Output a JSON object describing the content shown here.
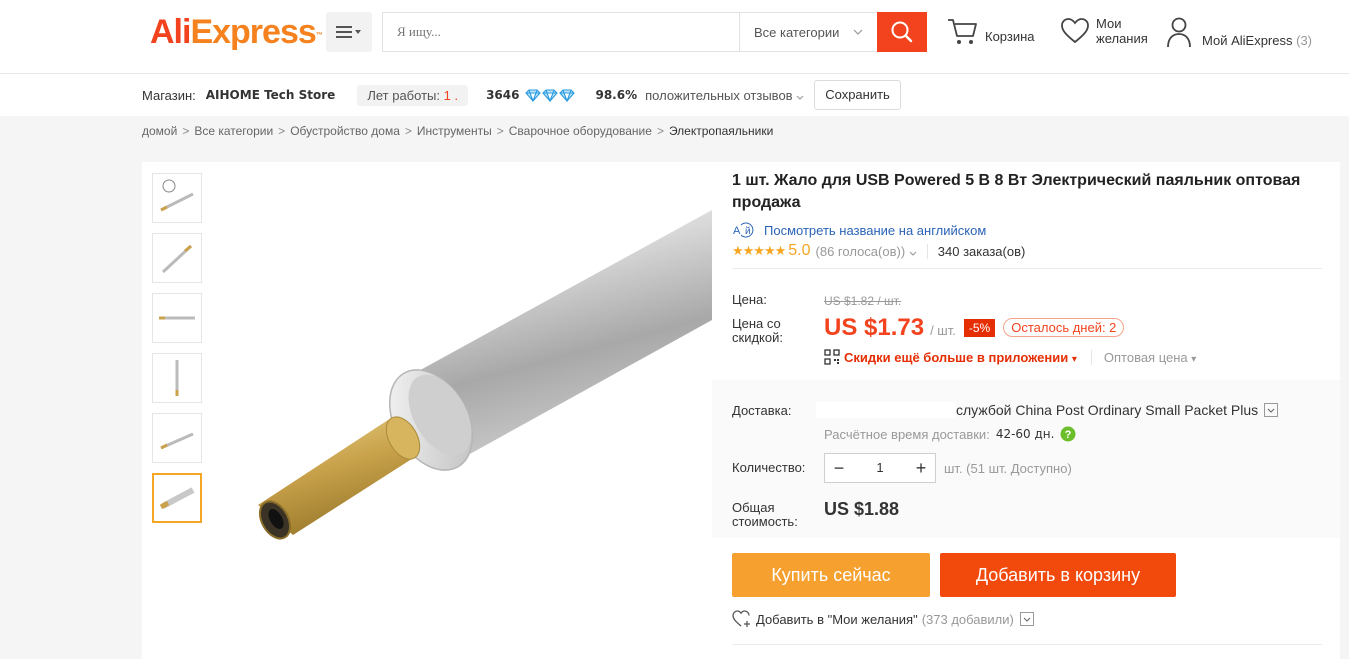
{
  "header": {
    "logo_ali": "Ali",
    "logo_express": "Express",
    "logo_tm": "™",
    "search_placeholder": "Я ищу...",
    "search_category": "Все категории",
    "cart_label": "Корзина",
    "wishlist_line1": "Мои",
    "wishlist_line2": "желания",
    "account_label": "Мой AliExpress",
    "account_count": "(3)"
  },
  "store": {
    "label": "Магазин:",
    "name": "AIHOME Tech Store",
    "years_label": "Лет работы:",
    "years_value": "1 .",
    "score": "3646",
    "positive_pct": "98.6%",
    "positive_label": "положительных отзывов",
    "save_label": "Сохранить"
  },
  "breadcrumb": [
    "домой",
    "Все категории",
    "Обустройство дома",
    "Инструменты",
    "Сварочное оборудование",
    "Электропаяльники"
  ],
  "product": {
    "title": "1 шт. Жало для USB Powered 5 В 8 Вт Электрический паяльник оптовая продажа",
    "view_english": "Посмотреть название на английском",
    "rating": "5.0",
    "votes": "(86 голоса(ов))",
    "orders": "340 заказа(ов)",
    "price_label": "Цена:",
    "old_price": "US $1.82 / шт.",
    "sale_price_label": "Цена со скидкой:",
    "sale_price": "US $1.73",
    "sale_unit": "/ шт.",
    "discount": "-5%",
    "days_left": "Осталось дней: 2",
    "app_discount": "Скидки ещё больше в приложении",
    "wholesale": "Оптовая цена",
    "shipping_label": "Доставка:",
    "shipping_method": "службой China Post Ordinary Small Packet Plus",
    "delivery_label": "Расчётное время доставки:",
    "delivery_value": "42-60 дн.",
    "quantity_label": "Количество:",
    "quantity_value": "1",
    "quantity_available": "шт. (51 шт. Доступно)",
    "total_label": "Общая стоимость:",
    "total_value": "US $1.88",
    "buy_now": "Купить сейчас",
    "add_to_cart": "Добавить в корзину",
    "add_wishlist": "Добавить в \"Мои желания\"",
    "wishlist_count": "(373 добавили)"
  },
  "colors": {
    "brand_red": "#f2431e",
    "brand_orange": "#f5821f",
    "buy_button": "#f6a030",
    "cart_button": "#f24a0d",
    "link_blue": "#2b64b6",
    "star": "#f5a623",
    "diamond": "#2a9be0"
  },
  "icons": [
    "menu-icon",
    "search-icon",
    "cart-icon",
    "heart-icon",
    "user-icon",
    "diamond-icon",
    "translate-icon",
    "star-icon",
    "qr-icon",
    "question-icon",
    "heart-plus-icon"
  ]
}
